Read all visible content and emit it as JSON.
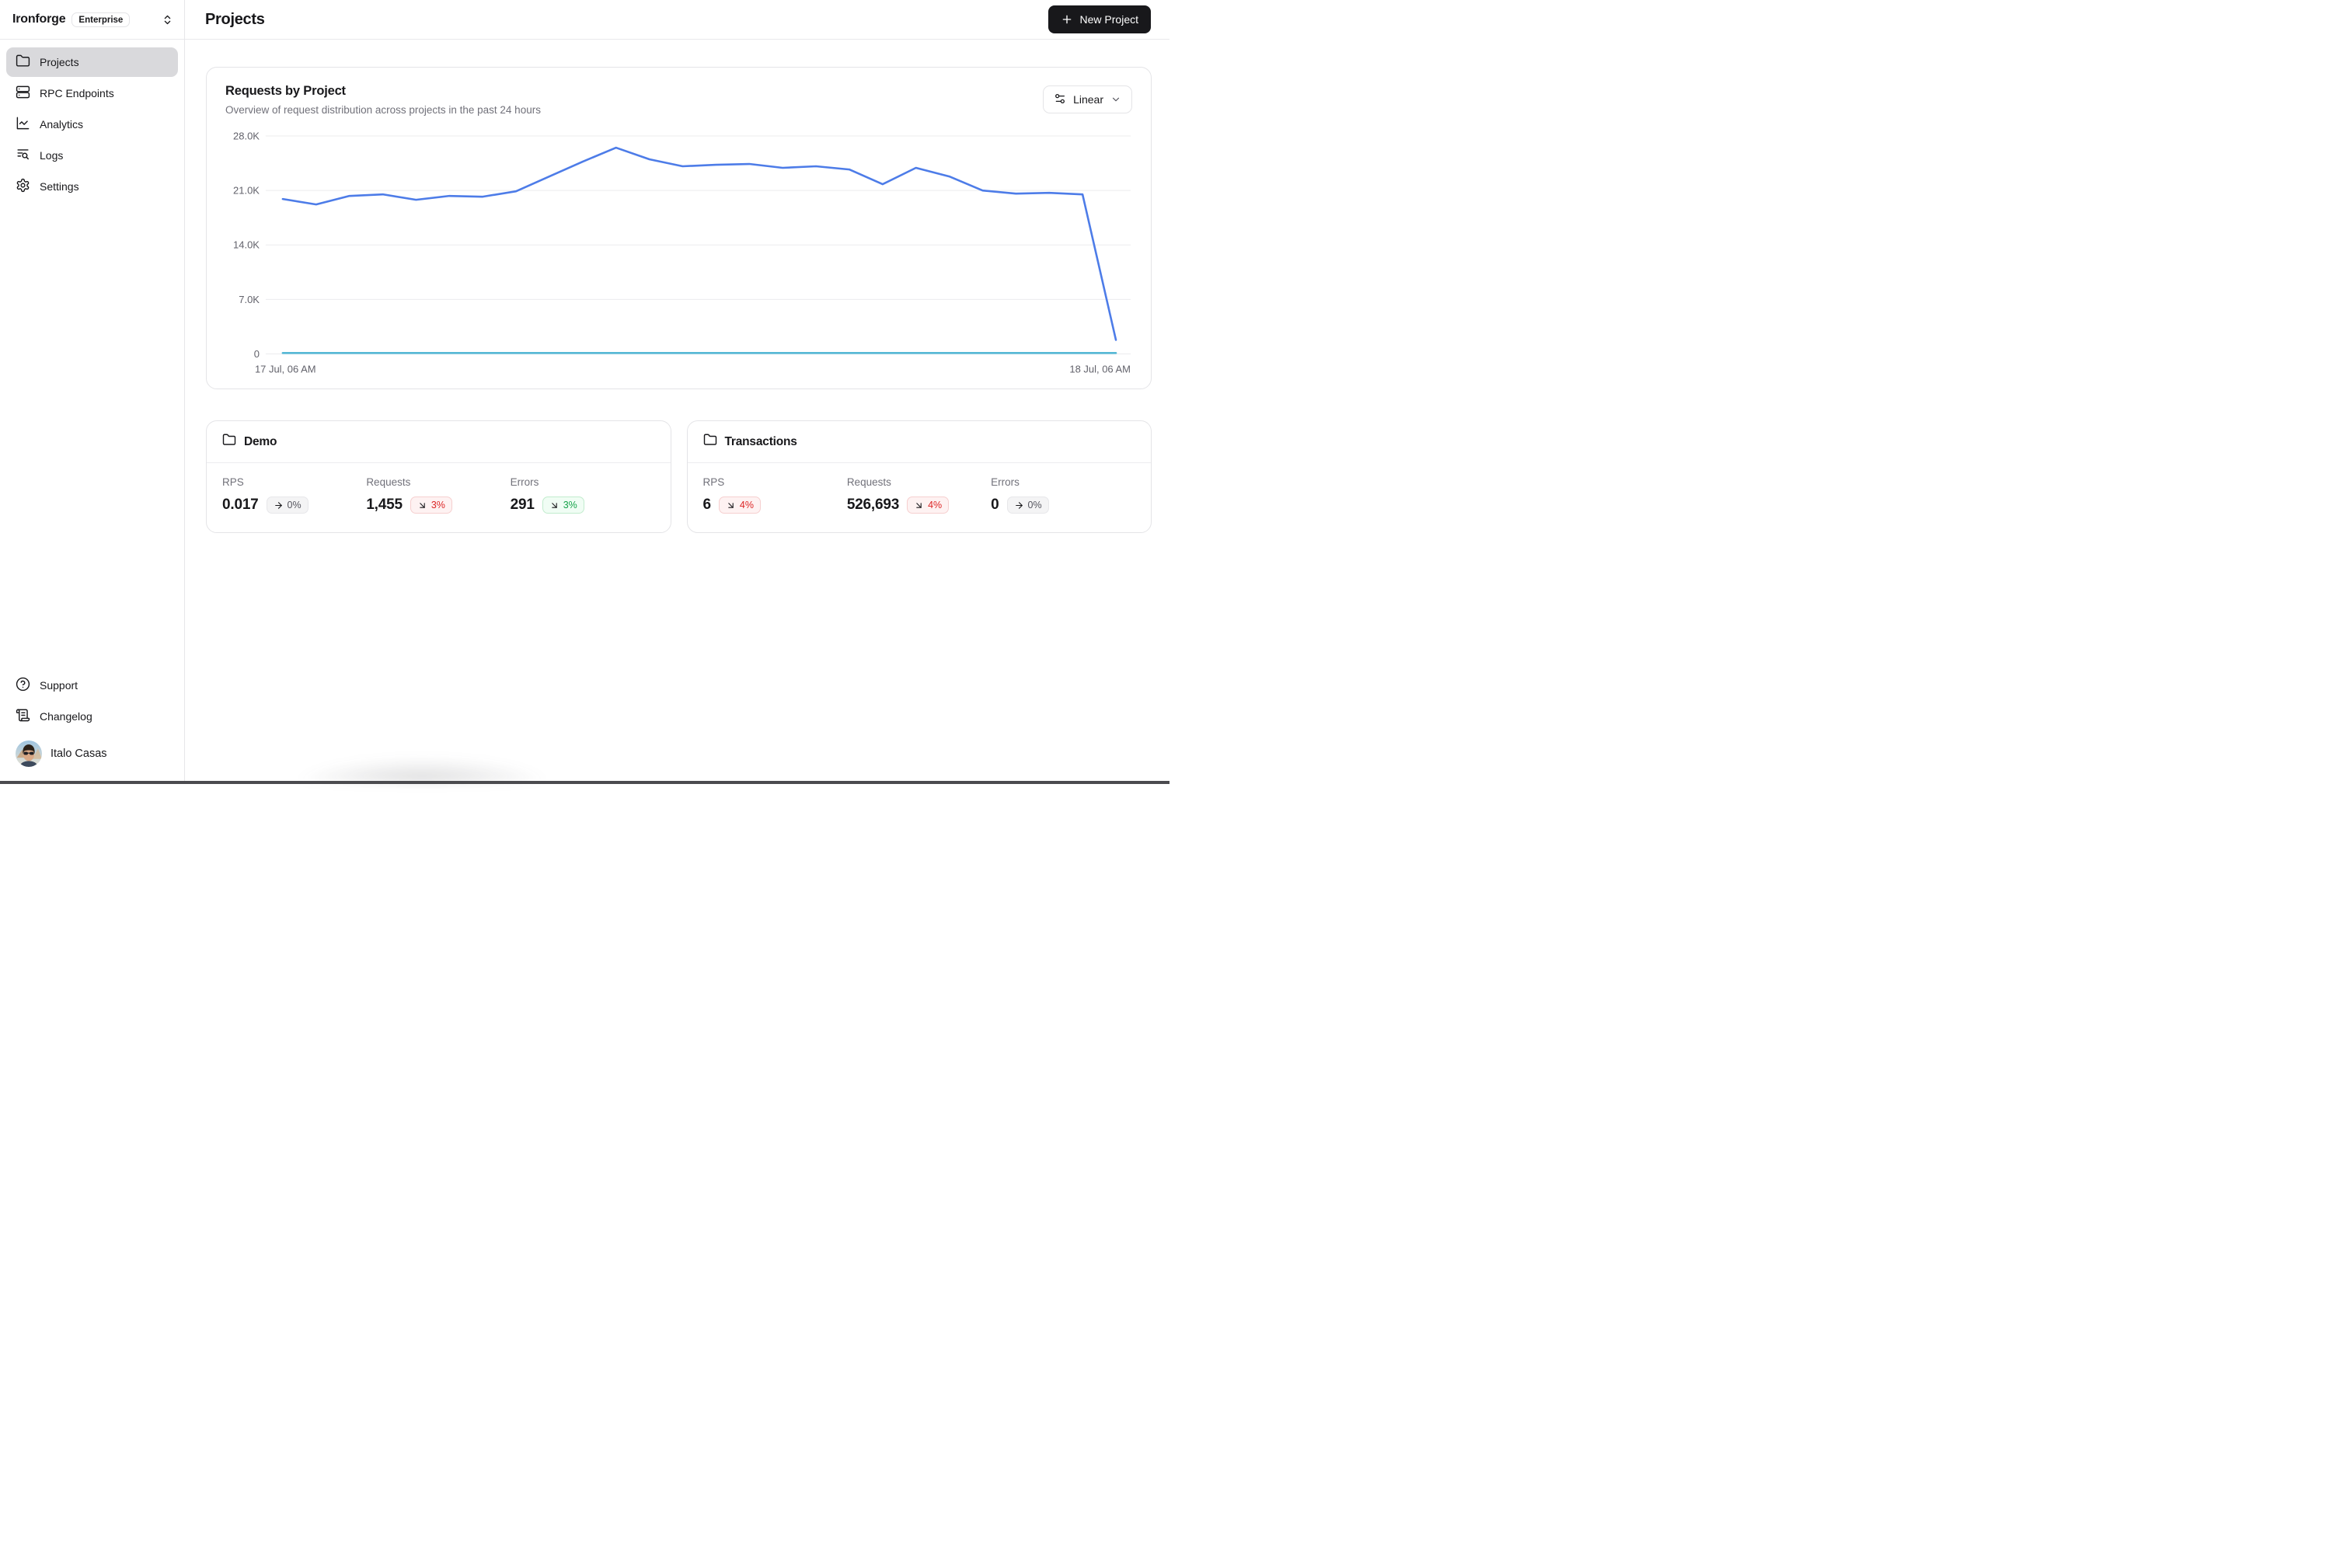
{
  "brand": {
    "name": "Ironforge",
    "plan_badge": "Enterprise"
  },
  "sidebar": {
    "items": [
      {
        "label": "Projects",
        "icon": "folder-icon",
        "active": true
      },
      {
        "label": "RPC Endpoints",
        "icon": "server-icon",
        "active": false
      },
      {
        "label": "Analytics",
        "icon": "chart-line-icon",
        "active": false
      },
      {
        "label": "Logs",
        "icon": "list-search-icon",
        "active": false
      },
      {
        "label": "Settings",
        "icon": "gear-icon",
        "active": false
      }
    ],
    "footer_items": [
      {
        "label": "Support",
        "icon": "help-circle-icon"
      },
      {
        "label": "Changelog",
        "icon": "scroll-icon"
      }
    ],
    "user": {
      "name": "Italo Casas"
    }
  },
  "header": {
    "title": "Projects",
    "new_project_label": "New Project"
  },
  "chart_card": {
    "title": "Requests by Project",
    "subtitle": "Overview of request distribution across projects in the past 24 hours",
    "scale_selector_label": "Linear"
  },
  "chart_data": {
    "type": "line",
    "title": "Requests by Project",
    "xlabel": "",
    "ylabel": "",
    "ylim": [
      0,
      28000
    ],
    "grid": "horizontal",
    "legend_position": "none",
    "yticks": [
      {
        "value": 28000,
        "label": "28.0K"
      },
      {
        "value": 21000,
        "label": "21.0K"
      },
      {
        "value": 14000,
        "label": "14.0K"
      },
      {
        "value": 7000,
        "label": "7.0K"
      },
      {
        "value": 0,
        "label": "0"
      }
    ],
    "x_axis_labels": {
      "start": "17 Jul, 06 AM",
      "end": "18 Jul, 06 AM"
    },
    "series": [
      {
        "name": "Transactions",
        "color": "#4d7ce8",
        "values": [
          19900,
          19200,
          20300,
          20500,
          19800,
          20300,
          20200,
          20900,
          22800,
          24700,
          26500,
          25000,
          24100,
          24300,
          24400,
          23900,
          24100,
          23700,
          21800,
          23900,
          22800,
          21000,
          20600,
          20700,
          20500,
          1800
        ]
      },
      {
        "name": "Demo",
        "color": "#55b8d6",
        "values": [
          120,
          120,
          120,
          120,
          120,
          120,
          120,
          120,
          120,
          120,
          120,
          120,
          120,
          120,
          120,
          120,
          120,
          120,
          120,
          120,
          120,
          120,
          120,
          120,
          120,
          120
        ]
      }
    ]
  },
  "project_cards": [
    {
      "name": "Demo",
      "stats": [
        {
          "label": "RPS",
          "value": "0.017",
          "trend": "flat",
          "trend_value": "0%",
          "trend_style": "neutral"
        },
        {
          "label": "Requests",
          "value": "1,455",
          "trend": "down",
          "trend_value": "3%",
          "trend_style": "negative"
        },
        {
          "label": "Errors",
          "value": "291",
          "trend": "down",
          "trend_value": "3%",
          "trend_style": "positive"
        }
      ]
    },
    {
      "name": "Transactions",
      "stats": [
        {
          "label": "RPS",
          "value": "6",
          "trend": "down",
          "trend_value": "4%",
          "trend_style": "negative"
        },
        {
          "label": "Requests",
          "value": "526,693",
          "trend": "down",
          "trend_value": "4%",
          "trend_style": "negative"
        },
        {
          "label": "Errors",
          "value": "0",
          "trend": "flat",
          "trend_value": "0%",
          "trend_style": "neutral"
        }
      ]
    }
  ],
  "colors": {
    "accent_line": "#4d7ce8",
    "secondary_line": "#55b8d6",
    "primary_button_bg": "#18181b",
    "active_nav_bg": "#d9d9dc",
    "border": "#e4e4e7",
    "muted_text": "#71717a",
    "negative": "#dc2626",
    "positive": "#16a34a"
  }
}
